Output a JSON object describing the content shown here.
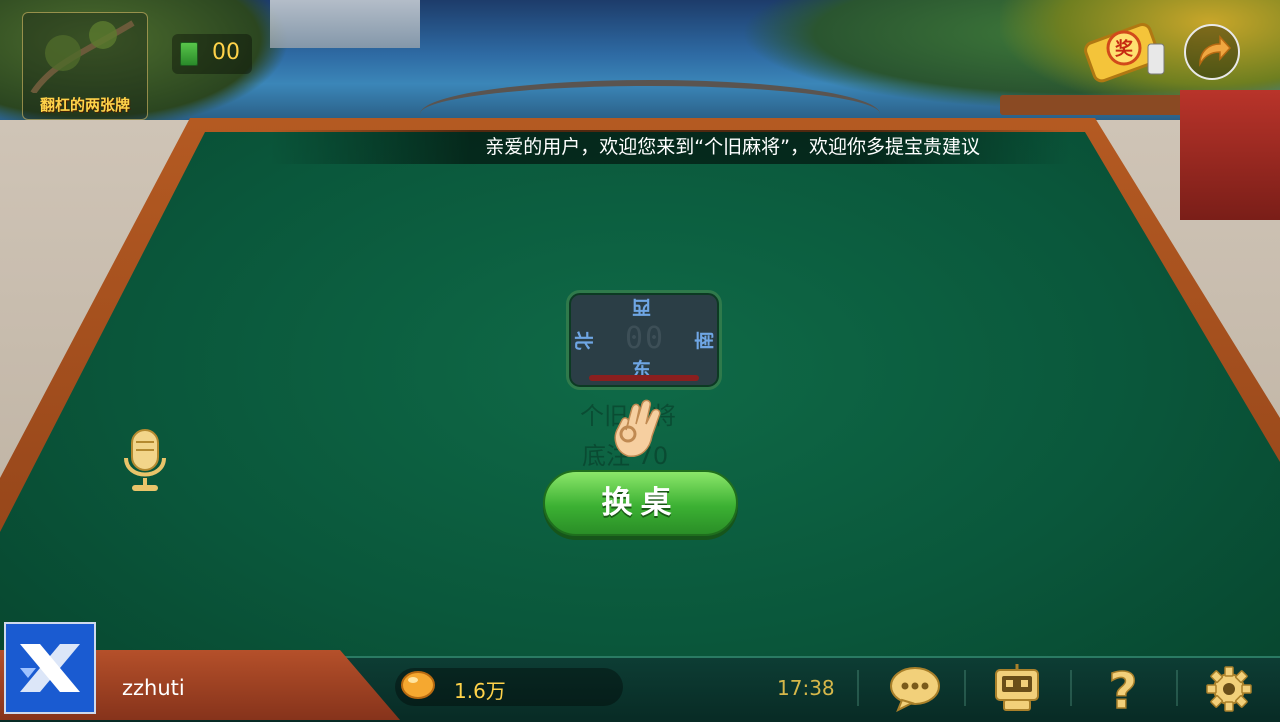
{
  "notice": "亲爱的用户，欢迎您来到“个旧麻将”，欢迎你多提宝贵建议",
  "tile_box": {
    "label": "翻杠的两张牌"
  },
  "tile_counter": "00",
  "compass": {
    "top": "西",
    "left": "北",
    "right": "南",
    "bottom": "东",
    "digits": "00"
  },
  "table_faint": {
    "line1": "个旧麻将",
    "line2": "底注 70"
  },
  "change_table_label": "换桌",
  "user": {
    "name": "zzhuti"
  },
  "coins": "1.6万",
  "clock": "17:38",
  "colors": {
    "felt": "#0a573b",
    "accent": "#ffd34a",
    "button": "#3cb133"
  },
  "icons": [
    "reward-scroll-icon",
    "share-arrow-icon",
    "microphone-icon",
    "ok-hand-icon",
    "chat-icon",
    "robot-icon",
    "help-icon",
    "settings-gear-icon"
  ]
}
